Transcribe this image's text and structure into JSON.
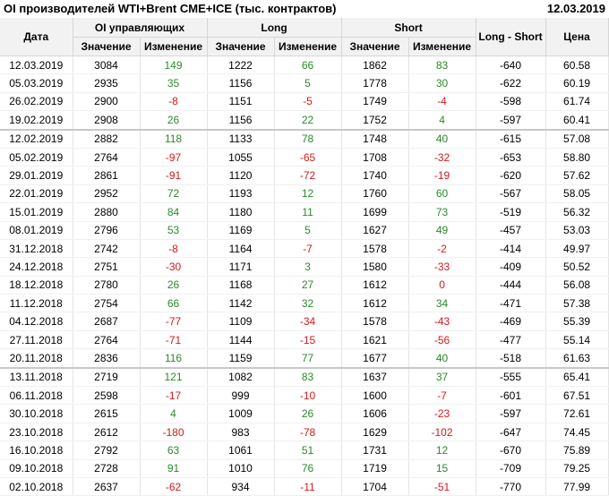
{
  "title": "OI производителей WTI+Brent CME+ICE (тыс. контрактов)",
  "date": "12.03.2019",
  "headers": {
    "date": "Дата",
    "oi_group": "OI управляющих",
    "long_group": "Long",
    "short_group": "Short",
    "long_short": "Long - Short",
    "price": "Цена",
    "value": "Значение",
    "change": "Изменение"
  },
  "colors": {
    "positive": "#2a8a2a",
    "negative": "#d21a1a"
  },
  "rows": [
    [
      "12.03.2019",
      "3084",
      "149",
      "1222",
      "66",
      "1862",
      "83",
      "-640",
      "60.58"
    ],
    [
      "05.03.2019",
      "2935",
      "35",
      "1156",
      "5",
      "1778",
      "30",
      "-622",
      "60.19"
    ],
    [
      "26.02.2019",
      "2900",
      "-8",
      "1151",
      "-5",
      "1749",
      "-4",
      "-598",
      "61.74"
    ],
    [
      "19.02.2019",
      "2908",
      "26",
      "1156",
      "22",
      "1752",
      "4",
      "-597",
      "60.41"
    ],
    [
      "12.02.2019",
      "2882",
      "118",
      "1133",
      "78",
      "1748",
      "40",
      "-615",
      "57.08"
    ],
    [
      "05.02.2019",
      "2764",
      "-97",
      "1055",
      "-65",
      "1708",
      "-32",
      "-653",
      "58.80"
    ],
    [
      "29.01.2019",
      "2861",
      "-91",
      "1120",
      "-72",
      "1740",
      "-19",
      "-620",
      "57.62"
    ],
    [
      "22.01.2019",
      "2952",
      "72",
      "1193",
      "12",
      "1760",
      "60",
      "-567",
      "58.05"
    ],
    [
      "15.01.2019",
      "2880",
      "84",
      "1180",
      "11",
      "1699",
      "73",
      "-519",
      "56.32"
    ],
    [
      "08.01.2019",
      "2796",
      "53",
      "1169",
      "5",
      "1627",
      "49",
      "-457",
      "53.03"
    ],
    [
      "31.12.2018",
      "2742",
      "-8",
      "1164",
      "-7",
      "1578",
      "-2",
      "-414",
      "49.97"
    ],
    [
      "24.12.2018",
      "2751",
      "-30",
      "1171",
      "3",
      "1580",
      "-33",
      "-409",
      "50.52"
    ],
    [
      "18.12.2018",
      "2780",
      "26",
      "1168",
      "27",
      "1612",
      "0",
      "-444",
      "56.08"
    ],
    [
      "11.12.2018",
      "2754",
      "66",
      "1142",
      "32",
      "1612",
      "34",
      "-471",
      "57.38"
    ],
    [
      "04.12.2018",
      "2687",
      "-77",
      "1109",
      "-34",
      "1578",
      "-43",
      "-469",
      "55.39"
    ],
    [
      "27.11.2018",
      "2764",
      "-71",
      "1144",
      "-15",
      "1621",
      "-56",
      "-477",
      "55.14"
    ],
    [
      "20.11.2018",
      "2836",
      "116",
      "1159",
      "77",
      "1677",
      "40",
      "-518",
      "61.63"
    ],
    [
      "13.11.2018",
      "2719",
      "121",
      "1082",
      "83",
      "1637",
      "37",
      "-555",
      "65.41"
    ],
    [
      "06.11.2018",
      "2598",
      "-17",
      "999",
      "-10",
      "1600",
      "-7",
      "-601",
      "67.51"
    ],
    [
      "30.10.2018",
      "2615",
      "4",
      "1009",
      "26",
      "1606",
      "-23",
      "-597",
      "72.61"
    ],
    [
      "23.10.2018",
      "2612",
      "-180",
      "983",
      "-78",
      "1629",
      "-102",
      "-647",
      "74.45"
    ],
    [
      "16.10.2018",
      "2792",
      "63",
      "1061",
      "51",
      "1731",
      "12",
      "-670",
      "75.89"
    ],
    [
      "09.10.2018",
      "2728",
      "91",
      "1010",
      "76",
      "1719",
      "15",
      "-709",
      "79.25"
    ],
    [
      "02.10.2018",
      "2637",
      "-62",
      "934",
      "-11",
      "1704",
      "-51",
      "-770",
      "77.99"
    ]
  ],
  "separator_before_rows": [
    4,
    17
  ]
}
